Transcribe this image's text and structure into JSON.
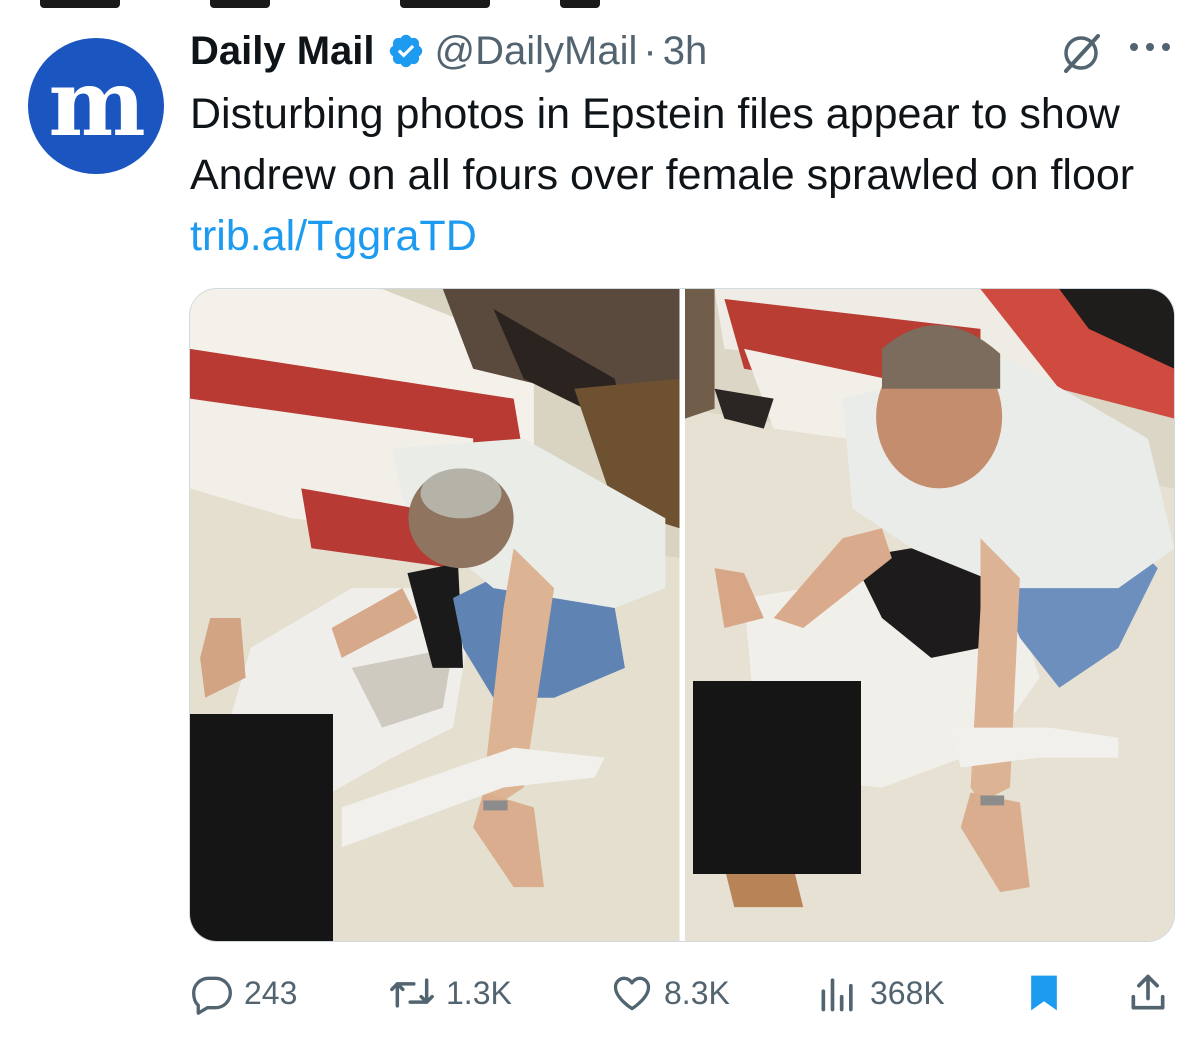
{
  "tweet": {
    "author": {
      "display_name": "Daily Mail",
      "handle": "@DailyMail",
      "verified": true,
      "avatar_glyph": "m",
      "avatar_color": "#1a55c0"
    },
    "separator": "·",
    "time": "3h",
    "text": "Disturbing photos in Epstein files appear to show Andrew on all fours over female sprawled on floor ",
    "link": "trib.al/TggraTD"
  },
  "media": {
    "count": 2,
    "items": [
      {
        "kind": "photo",
        "redacted": true
      },
      {
        "kind": "photo",
        "redacted": true
      }
    ]
  },
  "actions": {
    "replies": "243",
    "reposts": "1.3K",
    "likes": "8.3K",
    "views": "368K"
  },
  "colors": {
    "accent": "#1d9bf0",
    "muted": "#536471",
    "text": "#0f1419"
  },
  "icons": [
    "verified-badge-icon",
    "grok-icon",
    "more-icon",
    "reply-icon",
    "repost-icon",
    "like-icon",
    "views-icon",
    "bookmark-icon",
    "share-icon"
  ]
}
